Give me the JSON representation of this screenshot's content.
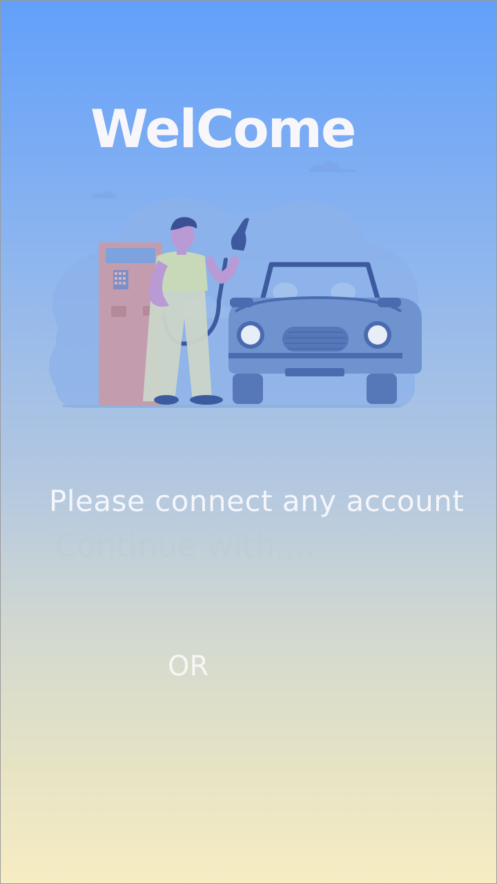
{
  "welcome": {
    "title": "WelCome"
  },
  "hero": {
    "illustration": "fuel-station-car-illustration"
  },
  "connect": {
    "message": "Please connect any account",
    "continue_label": "Continue with....",
    "divider_label": "OR"
  },
  "colors": {
    "gradient_top": "#62a0fa",
    "gradient_bottom": "#f7ecc3",
    "text": "#f7f7fb"
  }
}
